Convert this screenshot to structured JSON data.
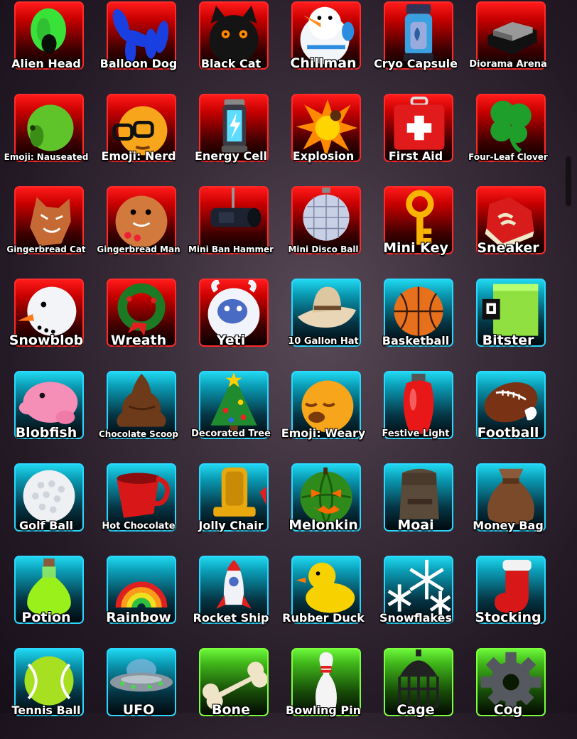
{
  "inventory": {
    "items": [
      {
        "name": "Alien Head",
        "rarity": "red",
        "icon": "alien-head-icon"
      },
      {
        "name": "Balloon Dog",
        "rarity": "red",
        "icon": "balloon-dog-icon"
      },
      {
        "name": "Black Cat",
        "rarity": "red",
        "icon": "black-cat-icon"
      },
      {
        "name": "Chillman",
        "rarity": "red",
        "icon": "chillman-icon"
      },
      {
        "name": "Cryo Capsule",
        "rarity": "red",
        "icon": "cryo-capsule-icon"
      },
      {
        "name": "Diorama Arena",
        "rarity": "red",
        "icon": "diorama-arena-icon"
      },
      {
        "name": "Emoji: Nauseated",
        "rarity": "red",
        "icon": "emoji-nauseated-icon"
      },
      {
        "name": "Emoji: Nerd",
        "rarity": "red",
        "icon": "emoji-nerd-icon"
      },
      {
        "name": "Energy Cell",
        "rarity": "red",
        "icon": "energy-cell-icon"
      },
      {
        "name": "Explosion",
        "rarity": "red",
        "icon": "explosion-icon"
      },
      {
        "name": "First Aid",
        "rarity": "red",
        "icon": "first-aid-icon"
      },
      {
        "name": "Four-Leaf Clover",
        "rarity": "red",
        "icon": "four-leaf-clover-icon"
      },
      {
        "name": "Gingerbread Cat",
        "rarity": "red",
        "icon": "gingerbread-cat-icon"
      },
      {
        "name": "Gingerbread Man",
        "rarity": "red",
        "icon": "gingerbread-man-icon"
      },
      {
        "name": "Mini Ban Hammer",
        "rarity": "red",
        "icon": "ban-hammer-icon"
      },
      {
        "name": "Mini Disco Ball",
        "rarity": "red",
        "icon": "disco-ball-icon"
      },
      {
        "name": "Mini Key",
        "rarity": "red",
        "icon": "key-icon"
      },
      {
        "name": "Sneaker",
        "rarity": "red",
        "icon": "sneaker-icon"
      },
      {
        "name": "Snowblob",
        "rarity": "red",
        "icon": "snowblob-icon"
      },
      {
        "name": "Wreath",
        "rarity": "red",
        "icon": "wreath-icon"
      },
      {
        "name": "Yeti",
        "rarity": "red",
        "icon": "yeti-icon"
      },
      {
        "name": "10 Gallon Hat",
        "rarity": "blue",
        "icon": "cowboy-hat-icon"
      },
      {
        "name": "Basketball",
        "rarity": "blue",
        "icon": "basketball-icon"
      },
      {
        "name": "Bitster",
        "rarity": "blue",
        "icon": "bitster-icon"
      },
      {
        "name": "Blobfish",
        "rarity": "blue",
        "icon": "blobfish-icon"
      },
      {
        "name": "Chocolate Scoop",
        "rarity": "blue",
        "icon": "chocolate-scoop-icon"
      },
      {
        "name": "Decorated Tree",
        "rarity": "blue",
        "icon": "christmas-tree-icon"
      },
      {
        "name": "Emoji: Weary",
        "rarity": "blue",
        "icon": "emoji-weary-icon"
      },
      {
        "name": "Festive Light",
        "rarity": "blue",
        "icon": "festive-light-icon"
      },
      {
        "name": "Football",
        "rarity": "blue",
        "icon": "football-icon"
      },
      {
        "name": "Golf Ball",
        "rarity": "blue",
        "icon": "golf-ball-icon"
      },
      {
        "name": "Hot Chocolate",
        "rarity": "blue",
        "icon": "hot-chocolate-icon"
      },
      {
        "name": "Jolly Chair",
        "rarity": "blue",
        "icon": "jolly-chair-icon"
      },
      {
        "name": "Melonkin",
        "rarity": "blue",
        "icon": "melonkin-icon"
      },
      {
        "name": "Moai",
        "rarity": "blue",
        "icon": "moai-icon"
      },
      {
        "name": "Money Bag",
        "rarity": "blue",
        "icon": "money-bag-icon"
      },
      {
        "name": "Potion",
        "rarity": "blue",
        "icon": "potion-icon"
      },
      {
        "name": "Rainbow",
        "rarity": "blue",
        "icon": "rainbow-icon"
      },
      {
        "name": "Rocket Ship",
        "rarity": "blue",
        "icon": "rocket-ship-icon"
      },
      {
        "name": "Rubber Duck",
        "rarity": "blue",
        "icon": "rubber-duck-icon"
      },
      {
        "name": "Snowflakes",
        "rarity": "blue",
        "icon": "snowflakes-icon"
      },
      {
        "name": "Stocking",
        "rarity": "blue",
        "icon": "stocking-icon"
      },
      {
        "name": "Tennis Ball",
        "rarity": "blue",
        "icon": "tennis-ball-icon"
      },
      {
        "name": "UFO",
        "rarity": "blue",
        "icon": "ufo-icon"
      },
      {
        "name": "Bone",
        "rarity": "green",
        "icon": "bone-icon"
      },
      {
        "name": "Bowling Pin",
        "rarity": "green",
        "icon": "bowling-pin-icon"
      },
      {
        "name": "Cage",
        "rarity": "green",
        "icon": "cage-icon"
      },
      {
        "name": "Cog",
        "rarity": "green",
        "icon": "cog-icon"
      }
    ]
  }
}
